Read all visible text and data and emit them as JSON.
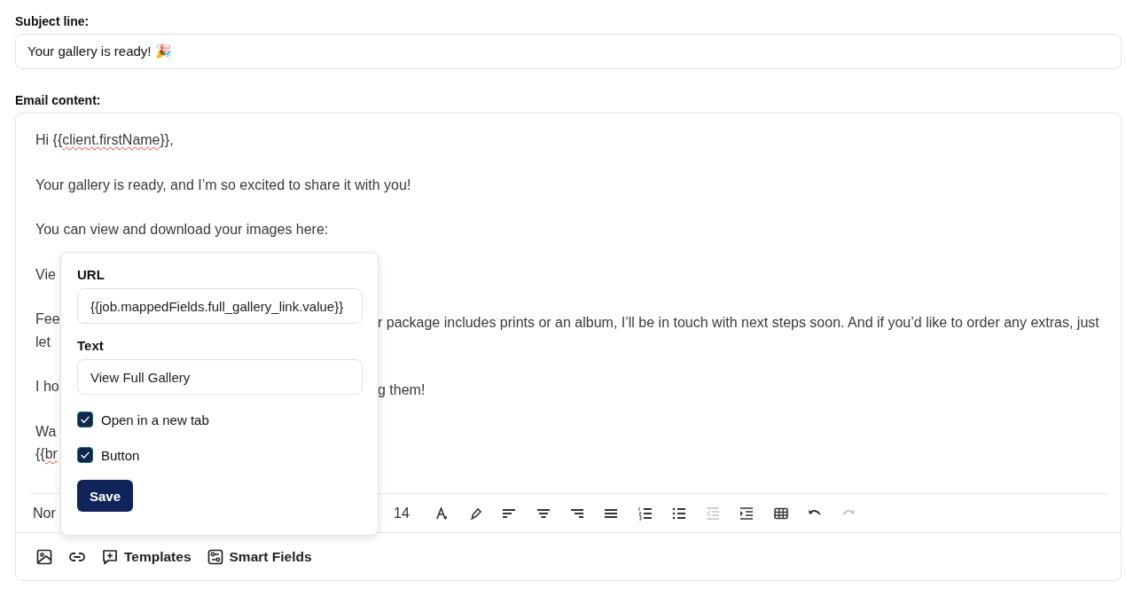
{
  "subject": {
    "label": "Subject line:",
    "value": "Your gallery is ready! 🎉"
  },
  "content": {
    "label": "Email content:",
    "paragraphs": [
      {
        "lines": [
          {
            "left": [
              {
                "text": "Hi {{",
                "misspelled": false
              },
              {
                "text": "client.firstName",
                "misspelled": true
              },
              {
                "text": "}},",
                "misspelled": false
              }
            ]
          }
        ]
      },
      {
        "lines": [
          {
            "left": [
              {
                "text": "Your gallery is ready, and I’m so excited to share it with you!",
                "misspelled": false
              }
            ]
          }
        ]
      },
      {
        "lines": [
          {
            "left": [
              {
                "text": "You can view and download your images here:",
                "misspelled": false
              }
            ]
          }
        ]
      },
      {
        "lines": [
          {
            "left": [
              {
                "text": "Vie",
                "misspelled": false
              }
            ]
          }
        ]
      },
      {
        "lines": [
          {
            "left": [
              {
                "text": "Fee",
                "misspelled": false
              }
            ],
            "right": "r package includes prints or an album, I’ll be in touch with next steps soon. And if you’d like to order any extras, just"
          },
          {
            "left": [
              {
                "text": "let",
                "misspelled": false
              }
            ]
          }
        ]
      },
      {
        "lines": [
          {
            "left": [
              {
                "text": "I ho",
                "misspelled": false
              }
            ],
            "right": "g them!"
          }
        ]
      },
      {
        "lines": [
          {
            "left": [
              {
                "text": "Wa",
                "misspelled": false
              }
            ]
          },
          {
            "left": [
              {
                "text": "{{",
                "misspelled": false
              },
              {
                "text": "br",
                "misspelled": true
              }
            ]
          }
        ]
      }
    ],
    "toolbar": {
      "style_select": "Nor",
      "font_size": "14",
      "tools": [
        {
          "kind": "text-color",
          "disabled": false
        },
        {
          "kind": "highlight",
          "disabled": false
        },
        {
          "kind": "align-left",
          "disabled": false
        },
        {
          "kind": "align-center",
          "disabled": false
        },
        {
          "kind": "align-right",
          "disabled": false
        },
        {
          "kind": "justify",
          "disabled": false
        },
        {
          "kind": "numbered-list",
          "disabled": false
        },
        {
          "kind": "bullet-list",
          "disabled": false
        },
        {
          "kind": "outdent",
          "disabled": true
        },
        {
          "kind": "indent",
          "disabled": false
        },
        {
          "kind": "table",
          "disabled": false
        },
        {
          "kind": "undo",
          "disabled": false
        },
        {
          "kind": "redo",
          "disabled": true
        }
      ]
    },
    "footer": [
      {
        "kind": "image"
      },
      {
        "kind": "link"
      },
      {
        "kind": "templates",
        "label": "Templates"
      },
      {
        "kind": "smart-fields",
        "label": "Smart Fields"
      }
    ]
  },
  "link_popover": {
    "url_label": "URL",
    "url": "{{job.mappedFields.full_gallery_link.value}}",
    "text_label": "Text",
    "text": "View Full Gallery",
    "options": [
      {
        "label": "Open in a new tab",
        "checked": true
      },
      {
        "label": "Button",
        "checked": true
      }
    ],
    "save": "Save"
  }
}
